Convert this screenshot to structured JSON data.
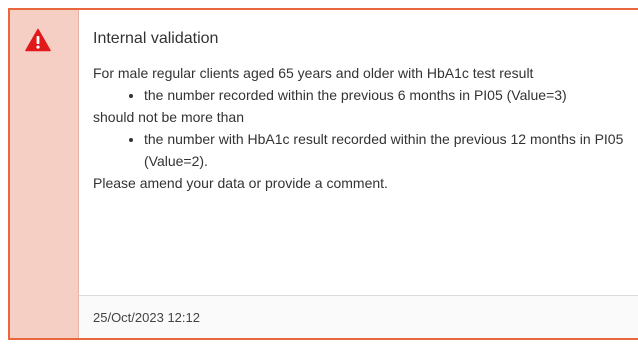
{
  "notification": {
    "icon": "warning-triangle-icon",
    "accent_color": "#e8673f",
    "icon_color": "#e2191b",
    "title": "Internal validation",
    "intro": "For male regular clients aged 65 years and older with HbA1c test result",
    "bullet1": "the number recorded within the previous 6 months in PI05 (Value=3)",
    "connector": "should not be more than",
    "bullet2": "the number with HbA1c result recorded within the previous 12 months in PI05 (Value=2).",
    "closing": "Please amend your data or provide a comment.",
    "timestamp": "25/Oct/2023 12:12"
  }
}
